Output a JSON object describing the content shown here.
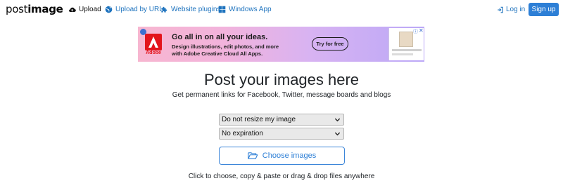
{
  "navbar": {
    "logo_left": "post",
    "logo_right": "image",
    "links": {
      "upload": "Upload",
      "upload_by_url": "Upload by URL",
      "website_plugins": "Website plugins",
      "windows_app": "Windows App"
    },
    "login": "Log in",
    "signup": "Sign up"
  },
  "ad": {
    "brand": "Adobe",
    "headline": "Go all in on all your ideas.",
    "line1": "Design illustrations, edit photos, and more",
    "line2": "with Adobe Creative Cloud All Apps.",
    "cta": "Try for free"
  },
  "main": {
    "title": "Post your images here",
    "subtitle": "Get permanent links for Facebook, Twitter, message boards and blogs",
    "resize_select": "Do not resize my image",
    "expiration_select": "No expiration",
    "choose_button": "Choose images",
    "hint": "Click to choose, copy & paste or drag & drop files anywhere"
  },
  "colors": {
    "accent": "#2d7fd6",
    "link": "#1e73be"
  }
}
